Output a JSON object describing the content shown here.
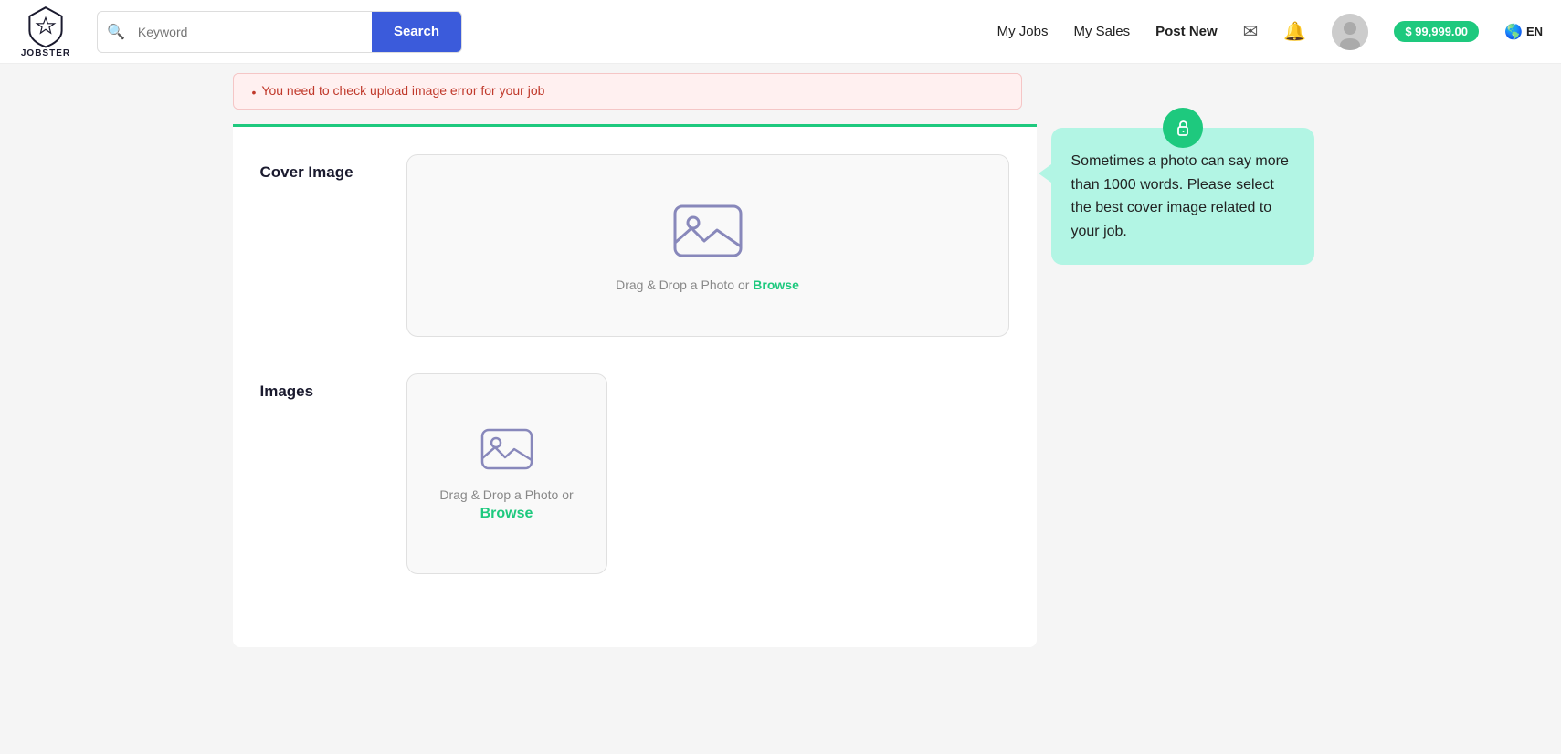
{
  "header": {
    "logo_text": "JOBSTER",
    "search_placeholder": "Keyword",
    "search_button": "Search",
    "nav": {
      "my_jobs": "My Jobs",
      "my_sales": "My Sales",
      "post_new": "Post New"
    },
    "balance": "$ 99,999.00",
    "lang": "EN"
  },
  "error_banner": {
    "message": "You need to check upload image error for your job"
  },
  "form": {
    "cover_image_label": "Cover Image",
    "cover_dropzone_text": "Drag & Drop a Photo or ",
    "cover_browse_label": "Browse",
    "images_label": "Images",
    "images_dropzone_text": "Drag & Drop a Photo or",
    "images_browse_label": "Browse"
  },
  "tooltip": {
    "icon": "🔒",
    "text": "Sometimes a photo can say more than 1000 words. Please select the best cover image related to your job."
  }
}
